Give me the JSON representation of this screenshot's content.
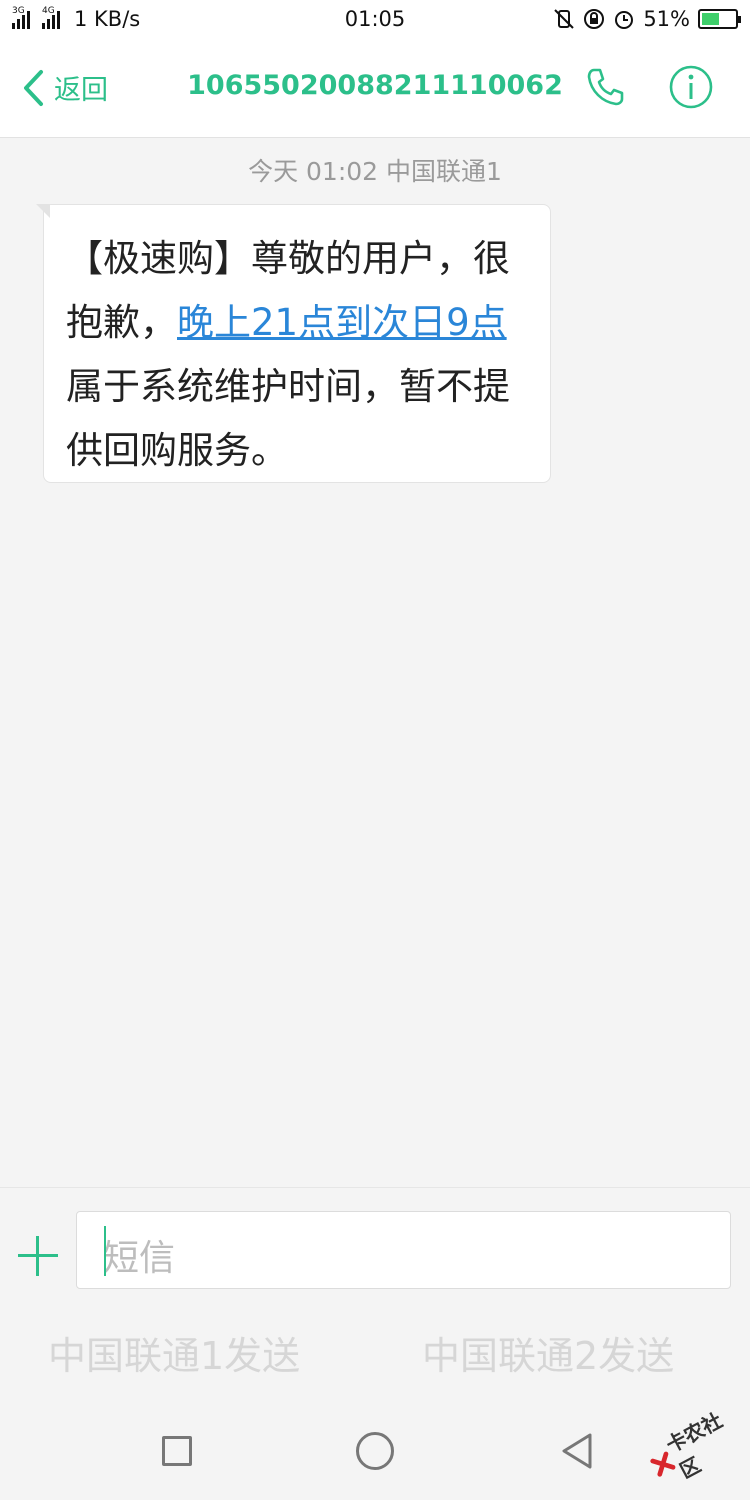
{
  "status_bar": {
    "net_left": "3G",
    "net_right": "4G",
    "speed": "1 KB/s",
    "time": "01:05",
    "battery": "51%",
    "battery_level": 0.51
  },
  "header": {
    "back_label": "返回",
    "contact_number": "1065502008821111006​2"
  },
  "conversation": {
    "timestamp": "今天 01:02  中国联通1",
    "message": {
      "text_before": "【极速购】尊敬的用户，很抱歉，",
      "link_text": "晚上21点到次日9点",
      "text_after": "属于系统维护时间，暂不提供回购服务。"
    }
  },
  "compose": {
    "placeholder": "短信",
    "send_sim1": "中国联通1发送",
    "send_sim2": "中国联通2发送"
  },
  "watermark": {
    "text": "卡农社区"
  },
  "colors": {
    "accent": "#2cbf8a",
    "link": "#2a86d8",
    "background": "#f4f4f4"
  }
}
